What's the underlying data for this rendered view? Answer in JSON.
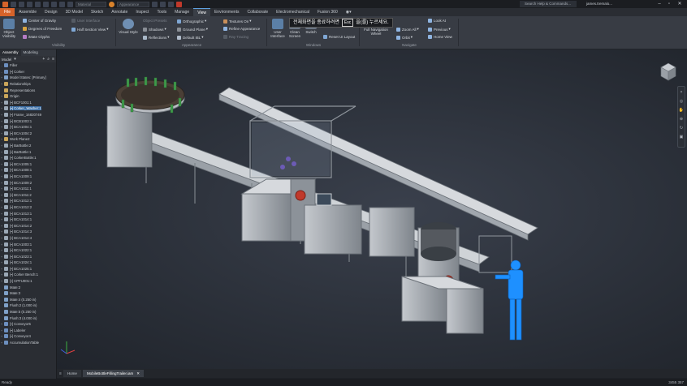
{
  "qat": {
    "material": "Material",
    "appearance": "Appearance"
  },
  "titlebar": {
    "help_search": "Search Help & Commands...",
    "user": "james.tremalo..."
  },
  "menu_tabs": [
    "File",
    "Assemble",
    "Design",
    "3D Model",
    "Sketch",
    "Annotate",
    "Inspect",
    "Tools",
    "Manage",
    "View",
    "Environments",
    "Collaborate",
    "Electromechanical",
    "Fusion 360"
  ],
  "menu_active": "View",
  "ribbon": {
    "visibility": {
      "object_visibility": "Object\nVisibility",
      "center_of_gravity": "Center of Gravity",
      "degrees_of_freedom": "Degrees of Freedom",
      "ilogic_glyphs": "iMate Glyphs",
      "user_interface_dim": "User Interface",
      "half_section": "Half Section View",
      "title": "Visibility"
    },
    "appearance": {
      "visual_style": "Visual Style",
      "shadows": "Shadows",
      "reflections": "Reflections",
      "orthographic": "Orthographic",
      "ground_plane": "Ground Plane",
      "default_ibl": "Default IBL",
      "textures_on": "Textures On",
      "refine_appearance": "Refine Appearance",
      "ray_tracing": "Ray Tracing",
      "object_presets": "Object Presets",
      "title": "Appearance"
    },
    "windows": {
      "user_interface": "User\nInterface",
      "clean_screen": "Clean\nScreen",
      "switch": "Switch",
      "reset_ui": "Reset UI Layout",
      "title": "Windows"
    },
    "navigate": {
      "full_nav_wheel": "Full Navigation\nWheel",
      "zoom_all": "Zoom All",
      "orbit": "Orbit",
      "look_at": "Look At",
      "previous": "Previous",
      "home_view": "Home View",
      "title": "Navigate"
    }
  },
  "banner": {
    "left": "전체화면을 종료하려면",
    "key": "Esc",
    "right": "을(를) 누르세요."
  },
  "browser": {
    "tabs": [
      "Assembly",
      "Modeling"
    ],
    "model_label": "Model",
    "tree": [
      {
        "exp": "-",
        "icon": "asm",
        "label": "Filler"
      },
      {
        "exp": "-",
        "icon": "asm",
        "label": "[▪] Corker"
      },
      {
        "exp": "+",
        "icon": "rel",
        "label": "Model States: [Primary]"
      },
      {
        "exp": "+",
        "icon": "fold",
        "label": "Relationships"
      },
      {
        "exp": "",
        "icon": "fold",
        "label": "Representations"
      },
      {
        "exp": "+",
        "icon": "fold",
        "label": "Origin"
      },
      {
        "exp": "+",
        "icon": "part",
        "label": "[▪] BCF1001:1"
      },
      {
        "exp": "+",
        "icon": "part",
        "label": "[▪] Corker_Washer:1",
        "sel": true
      },
      {
        "exp": "+",
        "icon": "part",
        "label": "[▪] Frame_16820749"
      },
      {
        "exp": "+",
        "icon": "part",
        "label": "[▪] BCB1003:1"
      },
      {
        "exp": "+",
        "icon": "part",
        "label": "[▪] BCA1004:1"
      },
      {
        "exp": "+",
        "icon": "part",
        "label": "[▪] BCA1004:2"
      },
      {
        "exp": "+",
        "icon": "fold",
        "label": "Work Plane2"
      },
      {
        "exp": "+",
        "icon": "part",
        "label": "[▪] BarBottle:2"
      },
      {
        "exp": "+",
        "icon": "part",
        "label": "[▪] BarBottle:1"
      },
      {
        "exp": "+",
        "icon": "part",
        "label": "[▪] CorkerBottle:1"
      },
      {
        "exp": "+",
        "icon": "part",
        "label": "[▪] BCA1005:1"
      },
      {
        "exp": "+",
        "icon": "part",
        "label": "[▪] BCA1008:1"
      },
      {
        "exp": "+",
        "icon": "part",
        "label": "[▪] BCA1009:1"
      },
      {
        "exp": "+",
        "icon": "part",
        "label": "[▪] BCA1009:2"
      },
      {
        "exp": "+",
        "icon": "part",
        "label": "[▪] BCA1011:1"
      },
      {
        "exp": "+",
        "icon": "part",
        "label": "[▪] BCA1011:2"
      },
      {
        "exp": "+",
        "icon": "part",
        "label": "[▪] BCA1012:1"
      },
      {
        "exp": "+",
        "icon": "part",
        "label": "[▪] BCA1012:2"
      },
      {
        "exp": "+",
        "icon": "part",
        "label": "[▪] BCA1013:1"
      },
      {
        "exp": "+",
        "icon": "part",
        "label": "[▪] BCA1014:1"
      },
      {
        "exp": "+",
        "icon": "part",
        "label": "[▪] BCA1014:2"
      },
      {
        "exp": "+",
        "icon": "part",
        "label": "[▪] BCA1014:3"
      },
      {
        "exp": "+",
        "icon": "part",
        "label": "[▪] BCA1014:4"
      },
      {
        "exp": "+",
        "icon": "part",
        "label": "[▪] BCA1003:1"
      },
      {
        "exp": "+",
        "icon": "part",
        "label": "[▪] BCA1022:1"
      },
      {
        "exp": "+",
        "icon": "part",
        "label": "[▪] BCA1023:1"
      },
      {
        "exp": "+",
        "icon": "part",
        "label": "[▪] BCA1024:1"
      },
      {
        "exp": "+",
        "icon": "part",
        "label": "[▪] BCA1025:1"
      },
      {
        "exp": "+",
        "icon": "part",
        "label": "[▪] Corker Bench:1"
      },
      {
        "exp": "+",
        "icon": "part",
        "label": "[▪] CPFU001:1"
      },
      {
        "exp": "",
        "icon": "rel",
        "label": "Mate:2"
      },
      {
        "exp": "",
        "icon": "rel",
        "label": "Mate:3"
      },
      {
        "exp": "",
        "icon": "rel",
        "label": "Mate:4 (0.250 in)"
      },
      {
        "exp": "",
        "icon": "rel",
        "label": "Flush:2 (1.000 in)"
      },
      {
        "exp": "",
        "icon": "rel",
        "label": "Mate:5 (0.250 in)"
      },
      {
        "exp": "",
        "icon": "rel",
        "label": "Flush:3 (4.000 in)"
      },
      {
        "exp": "+",
        "icon": "asm",
        "label": "[▪] Conveyor5"
      },
      {
        "exp": "+",
        "icon": "asm",
        "label": "[▪] Labeler"
      },
      {
        "exp": "+",
        "icon": "asm",
        "label": "[▪] Conveyor4"
      },
      {
        "exp": "+",
        "icon": "asm",
        "label": "AccumulationTable"
      }
    ]
  },
  "doc_tabs": {
    "home": "Home",
    "active_doc": "MobileBottleFillingTrailer.iam"
  },
  "status": {
    "text": "Ready",
    "right": "3455  357"
  },
  "viewcube_label": "view-cube",
  "colors": {
    "file_tab": "#d6632a",
    "accent_blue": "#3b6ea5",
    "viewport_bg": "#2a2f38",
    "machine_gray": "#c9cdd2",
    "person_blue": "#1e90ff"
  }
}
